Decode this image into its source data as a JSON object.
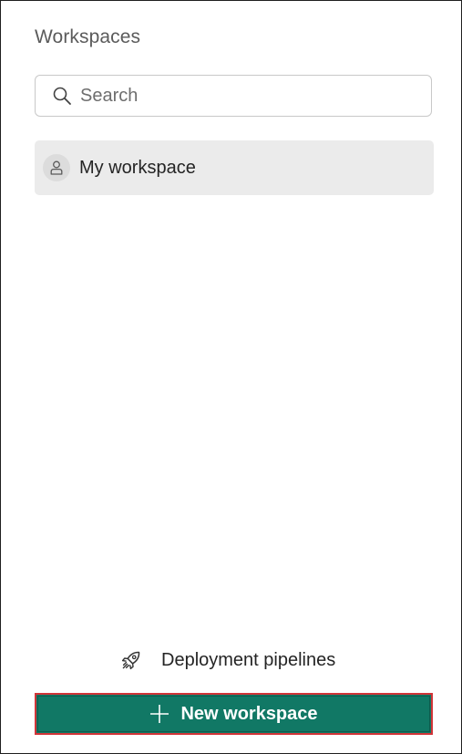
{
  "panel": {
    "title": "Workspaces"
  },
  "search": {
    "placeholder": "Search",
    "icon": "search-icon"
  },
  "workspaces": [
    {
      "label": "My workspace",
      "icon": "person-icon"
    }
  ],
  "footer": {
    "deployment_label": "Deployment pipelines",
    "deployment_icon": "rocket-icon",
    "new_workspace_label": "New workspace",
    "new_workspace_icon": "plus-icon"
  },
  "colors": {
    "accent": "#117865",
    "highlight_border": "#d13438",
    "selected_item_bg": "#ebebeb"
  }
}
